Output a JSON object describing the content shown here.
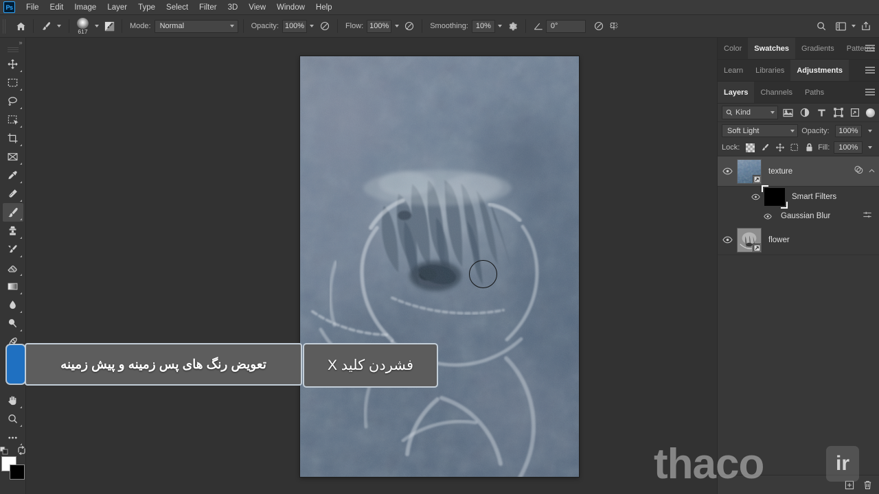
{
  "app": {
    "name": "Ps",
    "menu": [
      "File",
      "Edit",
      "Image",
      "Layer",
      "Type",
      "Select",
      "Filter",
      "3D",
      "View",
      "Window",
      "Help"
    ]
  },
  "options_bar": {
    "home_icon": "home-icon",
    "tool_preset_icon": "brush-tool-icon",
    "brush_size": "617",
    "brush_settings_icon": "brush-panel-icon",
    "mode_label": "Mode:",
    "mode_value": "Normal",
    "opacity_label": "Opacity:",
    "opacity_value": "100%",
    "pressure_opacity_icon": "pressure-opacity-icon",
    "flow_label": "Flow:",
    "flow_value": "100%",
    "airbrush_icon": "airbrush-icon",
    "smoothing_label": "Smoothing:",
    "smoothing_value": "10%",
    "smoothing_gear_icon": "gear-icon",
    "angle_icon": "angle-icon",
    "angle_value": "0°",
    "pressure_size_icon": "pressure-size-icon",
    "symmetry_icon": "symmetry-butterfly-icon",
    "search_icon": "search-icon",
    "workspace_icon": "workspace-icon",
    "share_icon": "share-icon"
  },
  "toolbar": {
    "collapse_icon": "expand-arrows-icon",
    "tools": [
      {
        "name": "move-tool",
        "icon": "move-icon",
        "active": false
      },
      {
        "name": "marquee-tool",
        "icon": "rectangular-marquee-icon",
        "active": false
      },
      {
        "name": "lasso-tool",
        "icon": "lasso-icon",
        "active": false
      },
      {
        "name": "object-selection-tool",
        "icon": "magic-wand-select-icon",
        "active": false
      },
      {
        "name": "crop-tool",
        "icon": "crop-icon",
        "active": false
      },
      {
        "name": "frame-tool",
        "icon": "frame-icon",
        "active": false
      },
      {
        "name": "eyedropper-tool",
        "icon": "eyedropper-icon",
        "active": false
      },
      {
        "name": "healing-brush-tool",
        "icon": "spot-healing-icon",
        "active": false
      },
      {
        "name": "brush-tool",
        "icon": "brush-icon",
        "active": true
      },
      {
        "name": "clone-stamp-tool",
        "icon": "clone-stamp-icon",
        "active": false
      },
      {
        "name": "history-brush-tool",
        "icon": "history-brush-icon",
        "active": false
      },
      {
        "name": "eraser-tool",
        "icon": "eraser-icon",
        "active": false
      },
      {
        "name": "gradient-tool",
        "icon": "gradient-icon",
        "active": false
      },
      {
        "name": "blur-tool",
        "icon": "blur-droplet-icon",
        "active": false
      },
      {
        "name": "dodge-tool",
        "icon": "dodge-icon",
        "active": false
      },
      {
        "name": "pen-tool",
        "icon": "pen-icon",
        "active": false
      },
      {
        "name": "type-tool",
        "icon": "type-icon",
        "active": false
      },
      {
        "name": "hand-tool",
        "icon": "hand-icon",
        "active": false
      },
      {
        "name": "zoom-tool",
        "icon": "zoom-magnifier-icon",
        "active": false
      },
      {
        "name": "edit-toolbar",
        "icon": "more-dots-icon",
        "active": false
      }
    ],
    "default_colors_icon": "default-colors-icon",
    "swap_colors_icon": "swap-colors-icon",
    "foreground_color": "#ffffff",
    "background_color": "#000000"
  },
  "tooltip": {
    "description": "تعویض رنگ های پس زمینه و پیش زمینه",
    "shortcut": "فشردن کلید X",
    "anchor_color": "#1f70c1"
  },
  "panels": {
    "tab_group_1": [
      {
        "label": "Color",
        "active": false
      },
      {
        "label": "Swatches",
        "active": true
      },
      {
        "label": "Gradients",
        "active": false
      },
      {
        "label": "Patterns",
        "active": false
      }
    ],
    "tab_group_2": [
      {
        "label": "Learn",
        "active": false
      },
      {
        "label": "Libraries",
        "active": false
      },
      {
        "label": "Adjustments",
        "active": true
      }
    ],
    "tab_group_3": [
      {
        "label": "Layers",
        "active": true
      },
      {
        "label": "Channels",
        "active": false
      },
      {
        "label": "Paths",
        "active": false
      }
    ],
    "menu_icon": "panel-menu-icon",
    "filter": {
      "kind_label": "Kind",
      "search_icon": "search-icon",
      "icons": [
        "filter-pixel-icon",
        "filter-adjustment-icon",
        "filter-type-icon",
        "filter-shape-icon",
        "filter-smart-object-icon"
      ],
      "toggle_icon": "filter-toggle-icon"
    },
    "blend_mode": "Soft Light",
    "opacity_label": "Opacity:",
    "opacity_value": "100%",
    "lock_label": "Lock:",
    "lock_icons": [
      "lock-transparent-pixels-icon",
      "lock-image-pixels-icon",
      "lock-position-icon",
      "lock-artboard-nesting-icon",
      "lock-all-icon"
    ],
    "fill_label": "Fill:",
    "fill_value": "100%",
    "layers": [
      {
        "name": "texture",
        "type": "smart-object",
        "visible": true,
        "selected": true,
        "fx_icon": "smart-filter-icon",
        "chevron_icon": "chevron-up-icon"
      },
      {
        "name": "Smart Filters",
        "type": "smart-filter-mask",
        "visible": true,
        "selected": false
      },
      {
        "name": "Gaussian Blur",
        "type": "smart-filter",
        "visible": true,
        "selected": false,
        "settings_icon": "filter-blending-options-icon"
      },
      {
        "name": "flower",
        "type": "smart-object",
        "visible": true,
        "selected": false
      }
    ],
    "bottom_icons": [
      "add-layer-icon",
      "delete-layer-icon"
    ]
  },
  "watermark": {
    "text": "thaco",
    "badge": "ir"
  }
}
